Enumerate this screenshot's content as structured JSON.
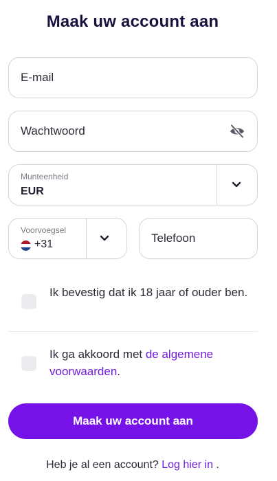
{
  "title": "Maak uw account aan",
  "email": {
    "placeholder": "E-mail"
  },
  "password": {
    "placeholder": "Wachtwoord",
    "icon": "eye-slash-icon"
  },
  "currency": {
    "label": "Munteenheid",
    "value": "EUR",
    "icon": "chevron-down-icon"
  },
  "prefix": {
    "label": "Voorvoegsel",
    "value": "+31",
    "flag": "netherlands-flag-icon",
    "icon": "chevron-down-icon"
  },
  "phone": {
    "placeholder": "Telefoon"
  },
  "age_check": {
    "text": "Ik bevestig dat ik 18 jaar of ouder ben."
  },
  "terms_check": {
    "text_prefix": "Ik ga akkoord met ",
    "link": "de algemene voorwaarden",
    "text_suffix": "."
  },
  "submit": {
    "label": "Maak uw account aan"
  },
  "footer": {
    "text": "Heb je al een account? ",
    "link": "Log hier in",
    "suffix": " ."
  },
  "colors": {
    "primary": "#7412e8",
    "link": "#6f1bd9",
    "title": "#1c1240",
    "border": "#d4d4dc"
  }
}
